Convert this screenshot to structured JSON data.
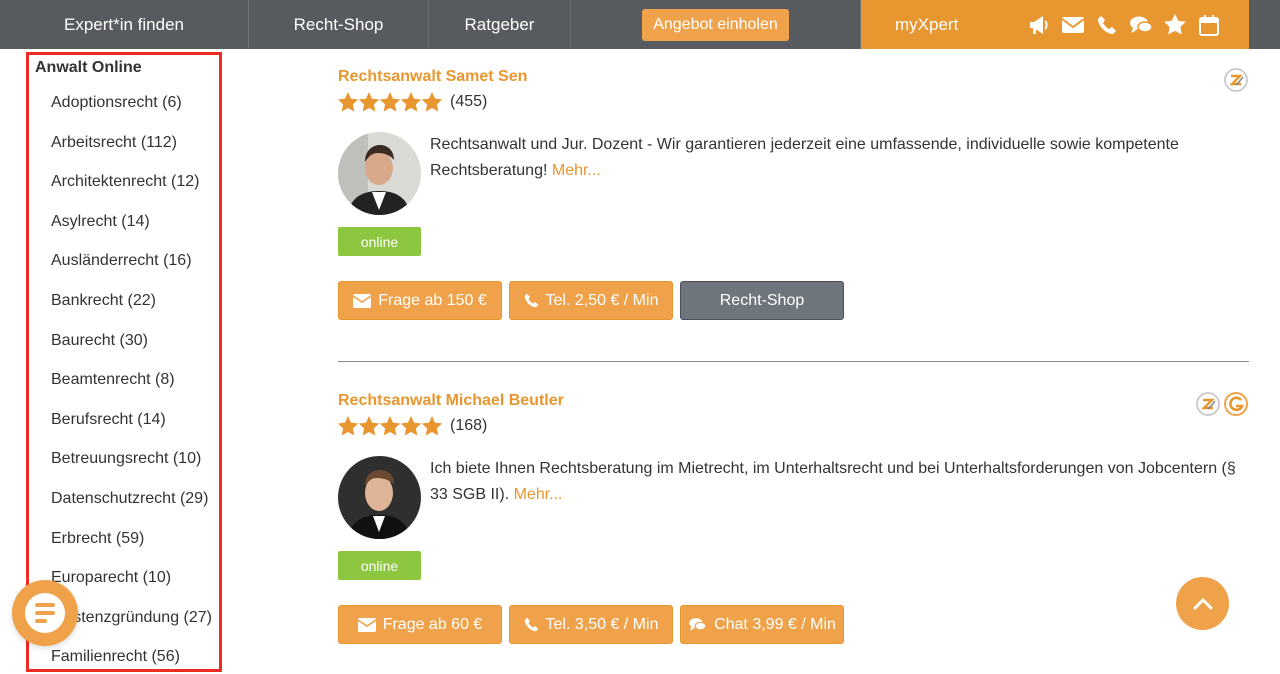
{
  "nav": {
    "items": [
      "Expert*in finden",
      "Recht-Shop",
      "Ratgeber"
    ],
    "cta": "Angebot einholen",
    "myxpert": "myXpert",
    "icons": [
      "megaphone-icon",
      "envelope-icon",
      "phone-icon",
      "chat-icon",
      "star-icon",
      "calendar-icon"
    ]
  },
  "sidebar": {
    "title": "Anwalt Online",
    "items": [
      "Adoptionsrecht (6)",
      "Arbeitsrecht (112)",
      "Architektenrecht (12)",
      "Asylrecht (14)",
      "Ausländerrecht (16)",
      "Bankrecht (22)",
      "Baurecht (30)",
      "Beamtenrecht (8)",
      "Berufsrecht (14)",
      "Betreuungsrecht (10)",
      "Datenschutzrecht (29)",
      "Erbrecht (59)",
      "Europarecht (10)",
      "Existenzgründung (27)",
      "Familienrecht (56)"
    ]
  },
  "listings": [
    {
      "name": "Rechtsanwalt Samet Sen",
      "rating": 5,
      "count": "(455)",
      "description": "Rechtsanwalt und Jur. Dozent - Wir garantieren jederzeit eine umfassende, individuelle sowie kompetente Rechtsberatung!",
      "more": "Mehr...",
      "status": "online",
      "buttons": [
        "Frage ab 150 €",
        "Tel. 2,50 € / Min",
        "Recht-Shop"
      ]
    },
    {
      "name": "Rechtsanwalt Michael Beutler",
      "rating": 5,
      "count": "(168)",
      "description": "Ich biete Ihnen Rechtsberatung im Mietrecht, im Unterhaltsrecht und bei Unterhaltsforderungen von Jobcentern (§ 33 SGB II).",
      "more": "Mehr...",
      "status": "online",
      "buttons": [
        "Frage ab 60 €",
        "Tel. 3,50 € / Min",
        "Chat 3,99 € / Min"
      ]
    }
  ],
  "colors": {
    "accent": "#e8962f",
    "nav": "#575b5f",
    "online": "#8dc63f",
    "highlight": "#ee2a24"
  }
}
